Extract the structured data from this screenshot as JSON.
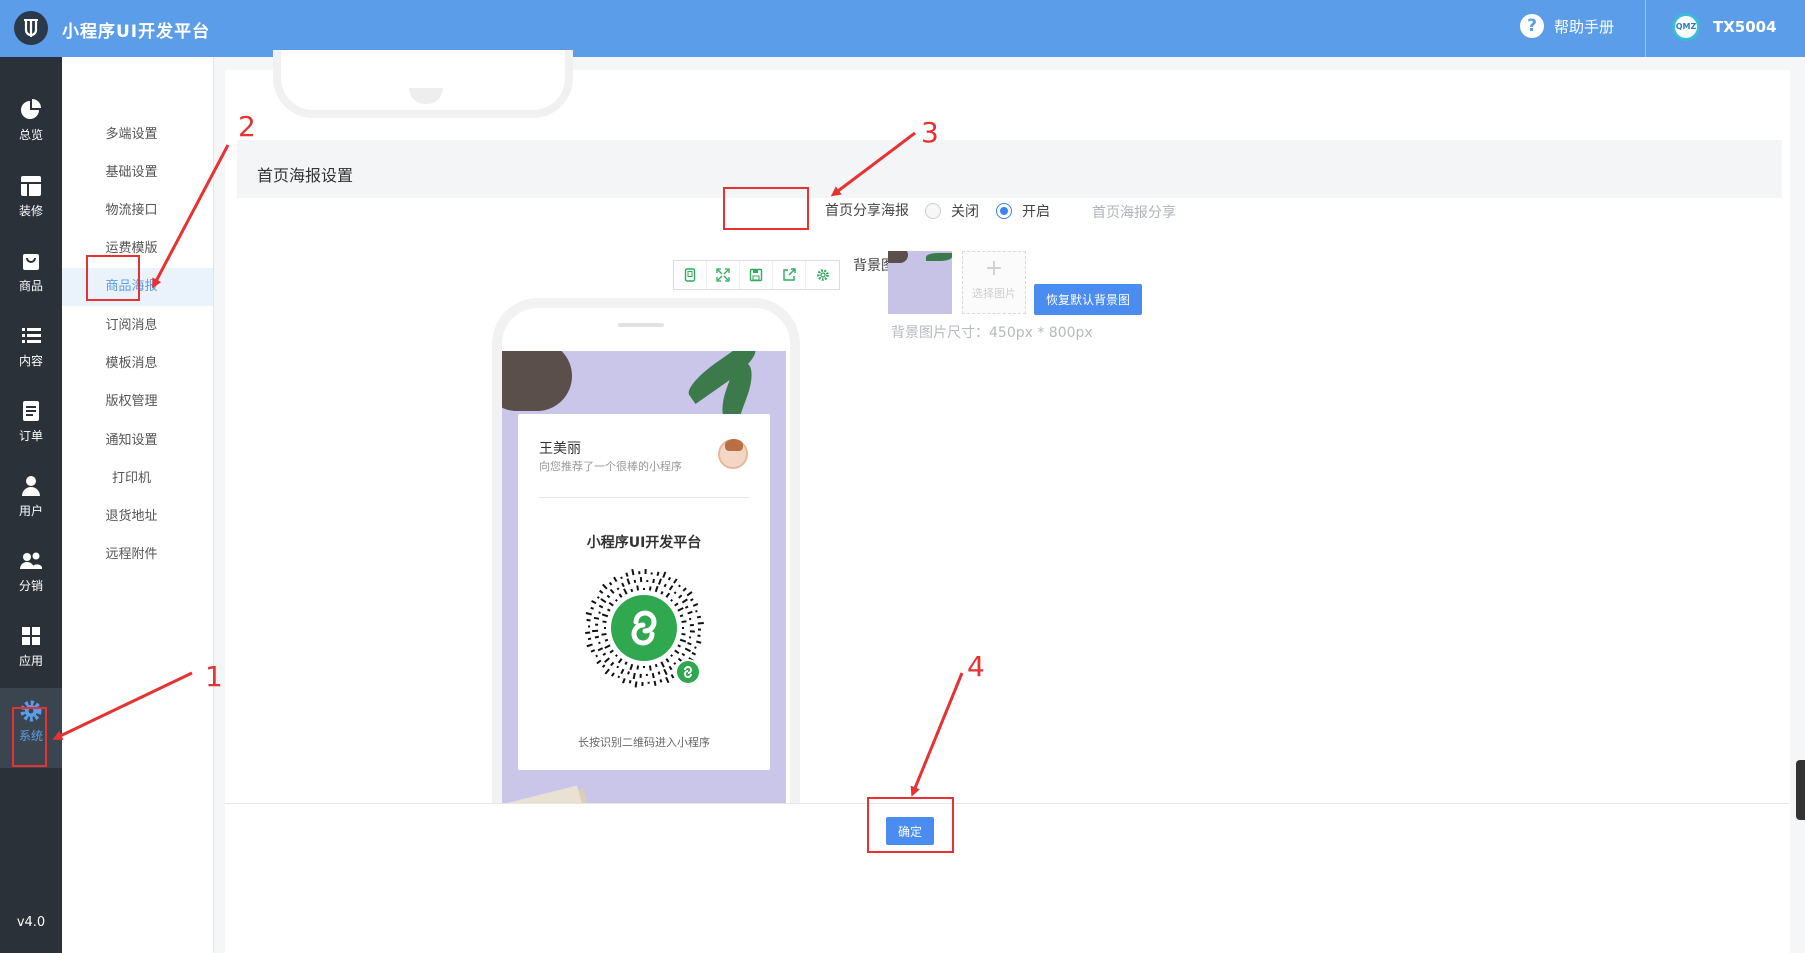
{
  "app": {
    "title": "小程序UI开发平台"
  },
  "header": {
    "help_label": "帮助手册",
    "username": "TX5004",
    "avatar_text": "QMZ"
  },
  "sidebar": {
    "items": [
      {
        "label": "总览",
        "icon": "pie-chart-icon"
      },
      {
        "label": "装修",
        "icon": "layout-icon"
      },
      {
        "label": "商品",
        "icon": "shopping-bag-icon"
      },
      {
        "label": "内容",
        "icon": "list-icon"
      },
      {
        "label": "订单",
        "icon": "document-icon"
      },
      {
        "label": "用户",
        "icon": "user-icon"
      },
      {
        "label": "分销",
        "icon": "users-icon"
      },
      {
        "label": "应用",
        "icon": "grid-icon"
      },
      {
        "label": "系统",
        "icon": "gear-icon",
        "active": true
      }
    ],
    "version": "v4.0"
  },
  "submenu": {
    "items": [
      "多端设置",
      "基础设置",
      "物流接口",
      "运费模版",
      "商品海报",
      "订阅消息",
      "模板消息",
      "版权管理",
      "通知设置",
      "打印机",
      "退货地址",
      "远程附件"
    ],
    "active": "商品海报"
  },
  "section": {
    "title": "首页海报设置"
  },
  "preview": {
    "name": "王美丽",
    "desc": "向您推荐了一个很棒的小程序",
    "title": "小程序UI开发平台",
    "footer": "长按识别二维码进入小程序"
  },
  "form": {
    "share_label": "首页分享海报",
    "option_off": "关闭",
    "option_on": "开启",
    "selected": "开启",
    "share_hint": "首页海报分享",
    "bg_label": "背景图片",
    "upload_text": "选择图片",
    "restore_button": "恢复默认背景图",
    "size_hint": "背景图片尺寸：450px * 800px"
  },
  "footer": {
    "confirm_button": "确定"
  },
  "annotations": [
    "1",
    "2",
    "3",
    "4"
  ],
  "colors": {
    "header": "#5b9de9",
    "sidebar": "#2b3138",
    "primary": "#4a8cf0",
    "annotation": "#e63232"
  }
}
